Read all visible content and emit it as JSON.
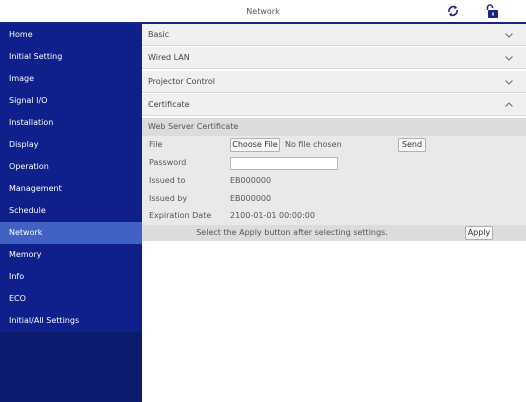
{
  "header": {
    "title": "Network",
    "refresh_icon": "refresh-icon",
    "lock_icon": "unlocked-padlock-icon",
    "accent_color": "#1a237e"
  },
  "sidebar": {
    "items": [
      {
        "label": "Home",
        "active": false
      },
      {
        "label": "Initial Setting",
        "active": false
      },
      {
        "label": "Image",
        "active": false
      },
      {
        "label": "Signal I/O",
        "active": false
      },
      {
        "label": "Installation",
        "active": false
      },
      {
        "label": "Display",
        "active": false
      },
      {
        "label": "Operation",
        "active": false
      },
      {
        "label": "Management",
        "active": false
      },
      {
        "label": "Schedule",
        "active": false
      },
      {
        "label": "Network",
        "active": true
      },
      {
        "label": "Memory",
        "active": false
      },
      {
        "label": "Info",
        "active": false
      },
      {
        "label": "ECO",
        "active": false
      },
      {
        "label": "Initial/All Settings",
        "active": false
      }
    ],
    "colors": {
      "background": "#0d1b6e",
      "item": "#0f1f8c",
      "active": "#3f62c4"
    }
  },
  "sections": [
    {
      "label": "Basic",
      "expanded": false
    },
    {
      "label": "Wired LAN",
      "expanded": false
    },
    {
      "label": "Projector Control",
      "expanded": false
    },
    {
      "label": "Certificate",
      "expanded": true
    }
  ],
  "certificate": {
    "subheader": "Web Server Certificate",
    "file_label": "File",
    "choose_file_label": "Choose File",
    "no_file_text": "No file chosen",
    "send_label": "Send",
    "password_label": "Password",
    "password_value": "",
    "issued_to_label": "Issued to",
    "issued_to_value": "EB000000",
    "issued_by_label": "Issued by",
    "issued_by_value": "EB000000",
    "expiration_label": "Expiration Date",
    "expiration_value": "2100-01-01 00:00:00"
  },
  "footer": {
    "message": "Select the Apply button after selecting settings.",
    "apply_label": "Apply"
  }
}
